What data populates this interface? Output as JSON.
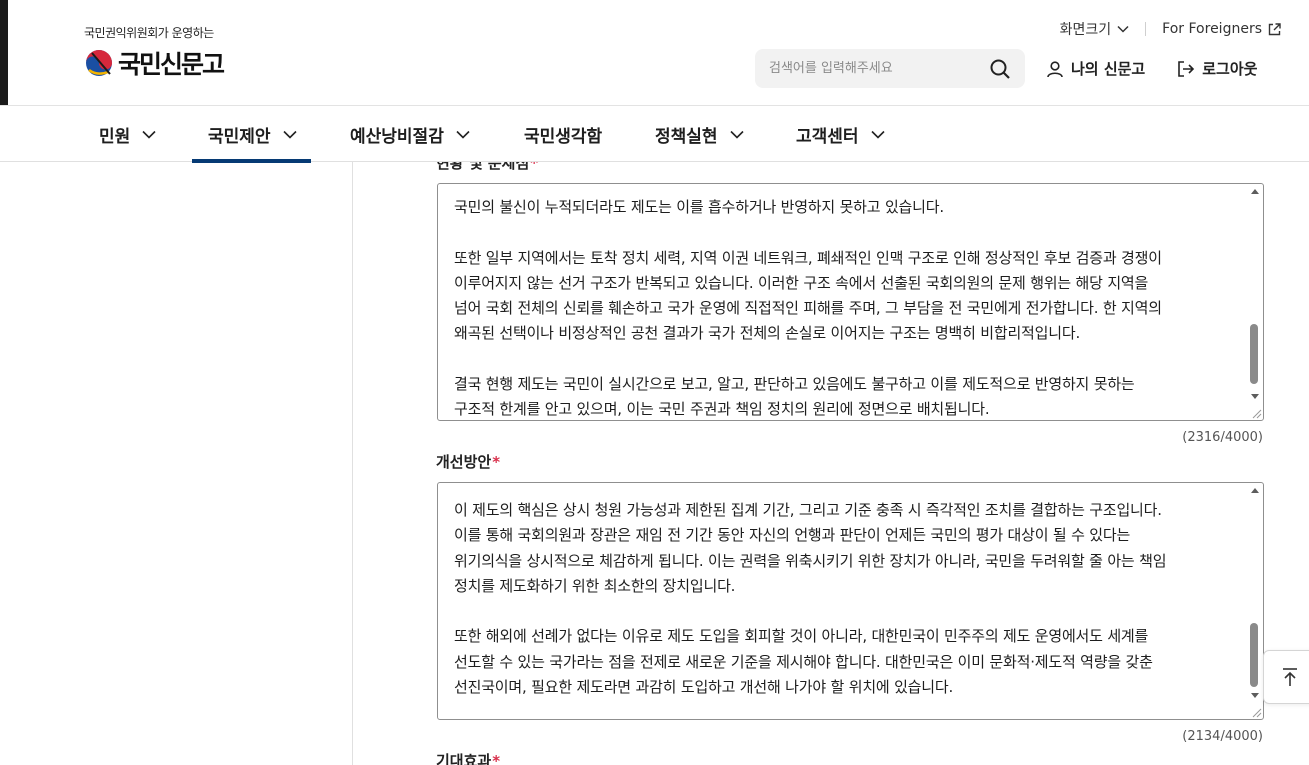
{
  "header": {
    "logo_sub": "국민권익위원회가 운영하는",
    "logo_text": "국민신문고",
    "screen_size_label": "화면크기",
    "foreign_label": "For Foreigners",
    "search_placeholder": "검색어를 입력해주세요",
    "my_label": "나의 신문고",
    "logout_label": "로그아웃"
  },
  "nav": {
    "items": [
      {
        "label": "민원",
        "has_menu": true
      },
      {
        "label": "국민제안",
        "has_menu": true,
        "active": true
      },
      {
        "label": "예산낭비절감",
        "has_menu": true
      },
      {
        "label": "국민생각함",
        "has_menu": false
      },
      {
        "label": "정책실현",
        "has_menu": true
      },
      {
        "label": "고객센터",
        "has_menu": true
      }
    ]
  },
  "form": {
    "field1": {
      "label": "현황 및 문제점",
      "lines": [
        "국민의 불신이 누적되더라도 제도는 이를 흡수하거나 반영하지 못하고 있습니다.",
        "",
        "또한 일부 지역에서는 토착 정치 세력, 지역 이권 네트워크, 폐쇄적인 인맥 구조로 인해 정상적인 후보 검증과 경쟁이",
        "이루어지지 않는 선거 구조가 반복되고 있습니다. 이러한 구조 속에서 선출된 국회의원의 문제 행위는 해당 지역을",
        "넘어 국회 전체의 신뢰를 훼손하고 국가 운영에 직접적인 피해를 주며, 그 부담을 전 국민에게 전가합니다. 한 지역의",
        "왜곡된 선택이나 비정상적인 공천 결과가 국가 전체의 손실로 이어지는 구조는 명백히 비합리적입니다.",
        "",
        "결국 현행 제도는 국민이 실시간으로 보고, 알고, 판단하고 있음에도 불구하고 이를 제도적으로 반영하지 못하는",
        "구조적 한계를 안고 있으며, 이는 국민 주권과 책임 정치의 원리에 정면으로 배치됩니다."
      ],
      "count": "(2316/4000)"
    },
    "field2": {
      "label": "개선방안",
      "lines": [
        "이 제도의 핵심은 상시 청원 가능성과 제한된 집계 기간, 그리고 기준 충족 시 즉각적인 조치를 결합하는 구조입니다.",
        "이를 통해 국회의원과 장관은 재임 전 기간 동안 자신의 언행과 판단이 언제든 국민의 평가 대상이 될 수 있다는",
        "위기의식을 상시적으로 체감하게 됩니다. 이는 권력을 위축시키기 위한 장치가 아니라, 국민을 두려워할 줄 아는 책임",
        "정치를 제도화하기 위한 최소한의 장치입니다.",
        "",
        "또한 해외에 선례가 없다는 이유로 제도 도입을 회피할 것이 아니라, 대한민국이 민주주의 제도 운영에서도 세계를",
        "선도할 수 있는 국가라는 점을 전제로 새로운 기준을 제시해야 합니다. 대한민국은 이미 문화적·제도적 역량을 갖춘",
        "선진국이며, 필요한 제도라면 과감히 도입하고 개선해 나가야 할 위치에 있습니다."
      ],
      "count": "(2134/4000)"
    },
    "field3": {
      "label": "기대효과"
    },
    "required_mark": "*"
  }
}
